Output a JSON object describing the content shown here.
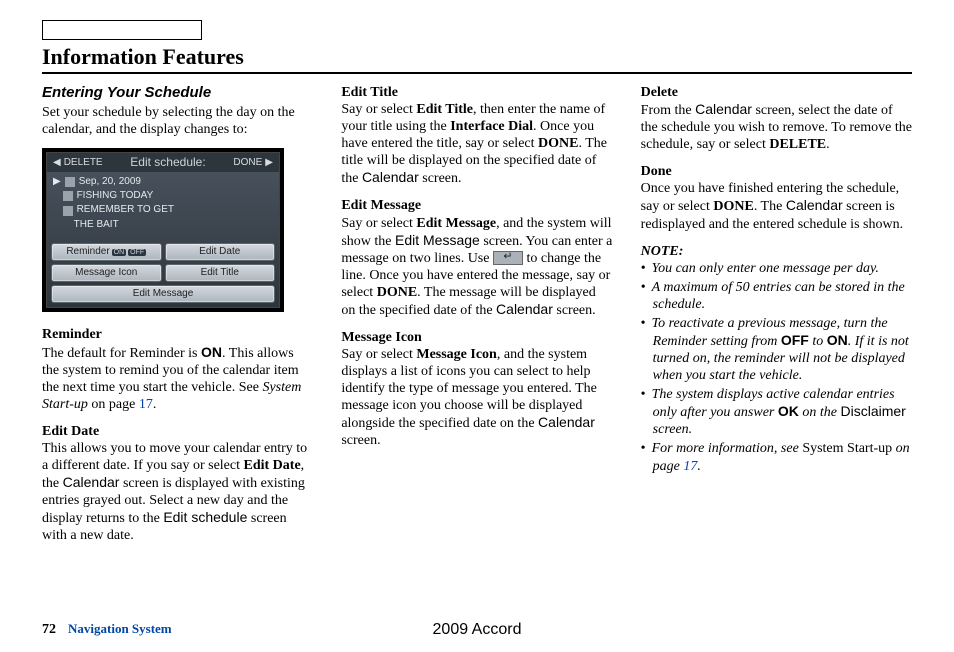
{
  "header": {
    "title": "Information Features"
  },
  "col1": {
    "section": "Entering Your Schedule",
    "intro": "Set your schedule by selecting the day on the calendar, and the display changes to:",
    "shot": {
      "delete": "DELETE",
      "title": "Edit schedule:",
      "done": "DONE",
      "date": "Sep, 20, 2009",
      "msg1": "FISHING TODAY",
      "msg2": "REMEMBER TO GET",
      "msg3": "THE BAIT",
      "reminder": "Reminder",
      "on": "ON",
      "off": "OFF",
      "editdate": "Edit Date",
      "msgicon": "Message Icon",
      "edittitle": "Edit Title",
      "editmsg": "Edit Message"
    },
    "reminder_h": "Reminder",
    "reminder_t1": "The default for Reminder is ",
    "reminder_on": "ON",
    "reminder_t2": ". This allows the system to remind you of the calendar item the next time you start the vehicle. See ",
    "reminder_link": "System Start-up",
    "reminder_t3": " on page ",
    "reminder_pg": "17",
    "editdate_h": "Edit Date",
    "editdate_t1": "This allows you to move your calendar entry to a different date. If you say or select ",
    "editdate_b": "Edit Date",
    "editdate_t2": ", the ",
    "editdate_cal": "Calendar",
    "editdate_t3": " screen is displayed with existing entries grayed out. Select a new day and the display returns to the ",
    "editdate_es": "Edit schedule",
    "editdate_t4": " screen with a new date."
  },
  "col2": {
    "et_h": "Edit Title",
    "et_t1": "Say or select ",
    "et_b1": "Edit Title",
    "et_t2": ", then enter the name of your title using the ",
    "et_b2": "Interface Dial",
    "et_t3": ". Once you have entered the title, say or select ",
    "et_b3": "DONE",
    "et_t4": ". The title will be displayed on the specified date of the ",
    "et_cal": "Calendar",
    "et_t5": " screen.",
    "em_h": "Edit Message",
    "em_t1": "Say or select ",
    "em_b1": "Edit Message",
    "em_t2": ", and the system will show the ",
    "em_s": "Edit Message",
    "em_t3": " screen. You can enter a message on two lines. Use ",
    "em_t4": " to change the line. Once you have entered the message, say or select ",
    "em_b2": "DONE",
    "em_t5": ". The message will be displayed on the specified date of the ",
    "em_cal": "Calendar",
    "em_t6": " screen.",
    "mi_h": "Message Icon",
    "mi_t1": "Say or select ",
    "mi_b1": "Message Icon",
    "mi_t2": ", and the system displays a list of icons you can select to help identify the type of message you entered. The message icon you choose will be displayed alongside the specified date on the ",
    "mi_cal": "Calendar",
    "mi_t3": " screen."
  },
  "col3": {
    "del_h": "Delete",
    "del_t1": "From the ",
    "del_cal": "Calendar",
    "del_t2": " screen, select the date of the schedule you wish to remove. To remove the schedule, say or select ",
    "del_b": "DELETE",
    "del_t3": ".",
    "done_h": "Done",
    "done_t1": "Once you have finished entering the schedule, say or select ",
    "done_b": "DONE",
    "done_t2": ". The ",
    "done_cal": "Calendar",
    "done_t3": " screen is redisplayed and the entered schedule is shown.",
    "note_h": "NOTE:",
    "n1": "You can only enter one message per day.",
    "n2": "A maximum of 50 entries can be stored in the schedule.",
    "n3a": "To reactivate a previous message, turn the Reminder setting from ",
    "n3_off": "OFF",
    "n3b": " to ",
    "n3_on": "ON",
    "n3c": ". If it is not turned on, the reminder will not be displayed when you start the vehicle.",
    "n4a": "The system displays active calendar entries only after you answer ",
    "n4_ok": "OK",
    "n4b": " on the ",
    "n4_disc": "Disclaimer",
    "n4c": " screen.",
    "n5a": "For more information, see ",
    "n5_link": "System Start-up",
    "n5b": " on page ",
    "n5_pg": "17",
    "n5c": "."
  },
  "footer": {
    "page": "72",
    "section": "Navigation System",
    "model": "2009  Accord"
  }
}
